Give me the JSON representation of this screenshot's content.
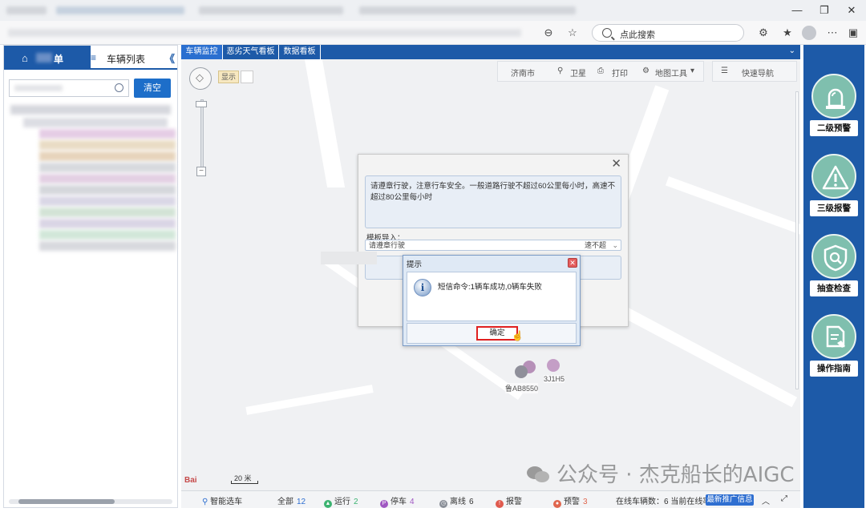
{
  "browser": {
    "search_placeholder": "点此搜索"
  },
  "left_panel": {
    "tab1_label": "单",
    "tab2_label": "车辆列表",
    "collapse": "《",
    "clear_button": "清空"
  },
  "main_tabs": [
    {
      "label": "车辆监控"
    },
    {
      "label": "恶劣天气看板"
    },
    {
      "label": "数据看板"
    }
  ],
  "map": {
    "show_label": "显示",
    "city": "济南市",
    "satellite": "卫星",
    "print": "打印",
    "map_tools": "地图工具",
    "quick_nav": "快速导航",
    "scale": "20 米",
    "baidu": "Bai",
    "vehicle_label_1": "鲁AB8550",
    "vehicle_label_2": "3J1H5",
    "watermark": "公众号 · 杰克船长的AIGC"
  },
  "sms_dialog": {
    "message": "请遵章行驶，注意行车安全。一般道路行驶不超过60公里每小时，高速不超过80公里每小时",
    "template_label": "模板导入：",
    "template_value": "请遵章行驶",
    "template_value_right": "速不超"
  },
  "prompt_dialog": {
    "title": "提示",
    "message": "短信命令:1辆车成功,0辆车失败",
    "ok": "确定"
  },
  "status_bar": {
    "smart_select": "智能选车",
    "all_label": "全部",
    "all_count": "12",
    "running_label": "运行",
    "running_count": "2",
    "parked_label": "停车",
    "parked_count": "4",
    "offline_label": "离线",
    "offline_count": "6",
    "alarm_label": "报警",
    "alarm_count": "",
    "warning_label": "预警",
    "warning_count": "3",
    "online_text": "在线车辆数：6 当前在线率",
    "promo": "最新推广信息"
  },
  "right_panel": [
    {
      "label": "二级预警",
      "icon": "siren-icon"
    },
    {
      "label": "三级报警",
      "icon": "warning-triangle-icon"
    },
    {
      "label": "抽查检查",
      "icon": "shield-search-icon"
    },
    {
      "label": "操作指南",
      "icon": "document-hand-icon"
    }
  ],
  "colors": {
    "brand_blue": "#1d5aa8",
    "teal": "#7fbfae",
    "alert_red": "#e02020"
  }
}
